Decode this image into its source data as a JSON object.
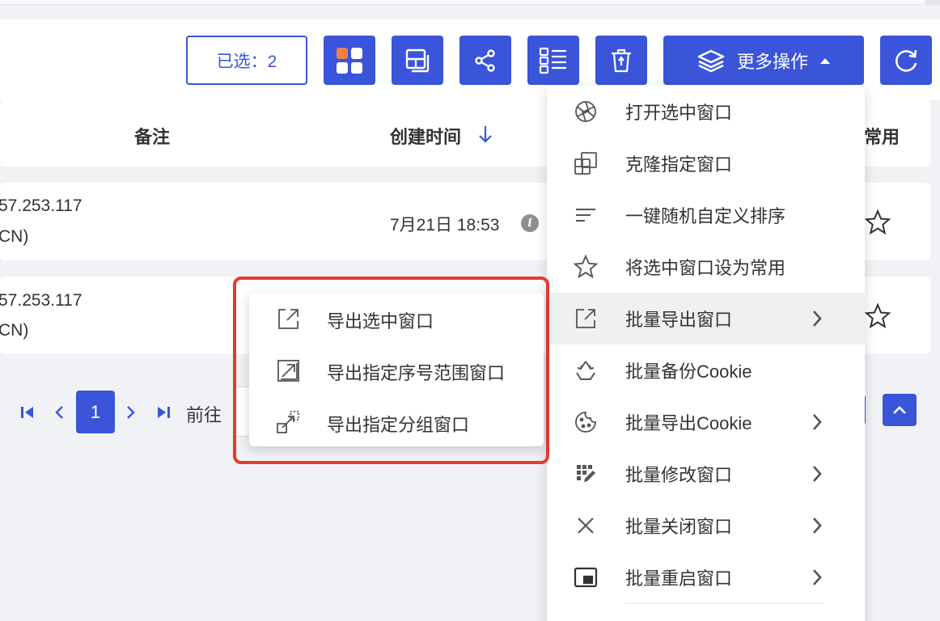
{
  "toolbar": {
    "selected_label": "已选：2",
    "more_actions_label": "更多操作",
    "buttons": [
      "layout-grid-icon",
      "panel-layout-icon",
      "share-icon",
      "list-view-icon",
      "trash-icon",
      "refresh-icon"
    ]
  },
  "table": {
    "headers": {
      "remark": "备注",
      "created": "创建时间",
      "favorite_partial": "常用"
    },
    "rows": [
      {
        "ip_partial": "57.253.117",
        "region_partial": "CN)",
        "created": "7月21日 18:53"
      },
      {
        "ip_partial": "57.253.117",
        "region_partial": "CN)"
      }
    ]
  },
  "pagination": {
    "current_page": "1",
    "goto_label": "前往"
  },
  "menu": {
    "items": [
      {
        "label": "打开选中窗口",
        "icon": "aperture-icon"
      },
      {
        "label": "克隆指定窗口",
        "icon": "clone-icon"
      },
      {
        "label": "一键随机自定义排序",
        "icon": "sort-lines-icon"
      },
      {
        "label": "将选中窗口设为常用",
        "icon": "star-icon"
      },
      {
        "label": "批量导出窗口",
        "icon": "export-icon",
        "has_submenu": true,
        "active": true
      },
      {
        "label": "批量备份Cookie",
        "icon": "recycle-icon"
      },
      {
        "label": "批量导出Cookie",
        "icon": "cookie-icon",
        "has_submenu": true
      },
      {
        "label": "批量修改窗口",
        "icon": "edit-grid-icon",
        "has_submenu": true
      },
      {
        "label": "批量关闭窗口",
        "icon": "close-icon",
        "has_submenu": true
      },
      {
        "label": "批量重启窗口",
        "icon": "window-restart-icon",
        "has_submenu": true
      }
    ]
  },
  "submenu": {
    "items": [
      {
        "label": "导出选中窗口",
        "icon": "export-selected-icon"
      },
      {
        "label": "导出指定序号范围窗口",
        "icon": "export-range-icon"
      },
      {
        "label": "导出指定分组窗口",
        "icon": "export-group-icon"
      }
    ]
  },
  "colors": {
    "primary": "#3a55d9",
    "highlight_border": "#e53b2c",
    "accent_orange": "#e9834a"
  }
}
